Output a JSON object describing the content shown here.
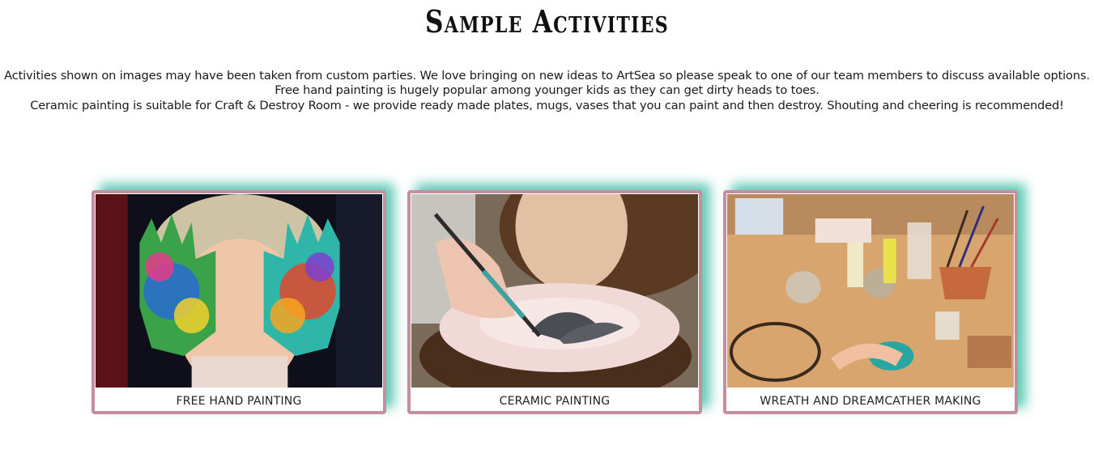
{
  "section": {
    "title": "Sample Activities",
    "intro": [
      "Activities shown on images may have been taken from custom parties. We love bringing on new ideas to ArtSea so please speak to one of our team members to discuss available options.",
      "Free hand painting is hugely popular among younger kids as they can get dirty heads to toes.",
      "Ceramic painting is suitable for Craft & Destroy Room - we provide ready made plates, mugs, vases that you can paint and then destroy. Shouting and cheering is recommended!"
    ]
  },
  "cards": [
    {
      "caption": "FREE HAND PAINTING"
    },
    {
      "caption": "CERAMIC PAINTING"
    },
    {
      "caption": "WREATH AND DREAMCATHER MAKING"
    }
  ],
  "colors": {
    "card_border": "#c48e9f",
    "card_glow": "#48c0aa"
  }
}
